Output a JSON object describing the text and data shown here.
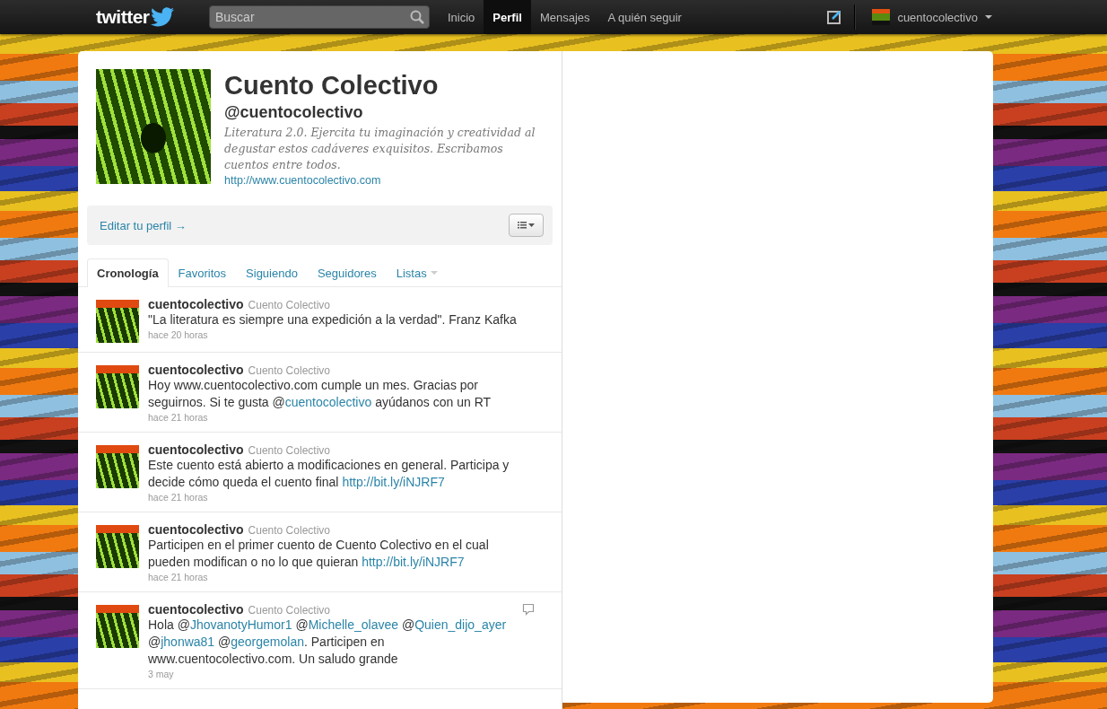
{
  "topbar": {
    "logo": "twitter",
    "search": {
      "placeholder": "Buscar"
    },
    "nav": [
      {
        "label": "Inicio",
        "selected": false
      },
      {
        "label": "Perfil",
        "selected": true
      },
      {
        "label": "Mensajes",
        "selected": false
      },
      {
        "label": "A quién seguir",
        "selected": false
      }
    ],
    "account": {
      "username": "cuentocolectivo"
    }
  },
  "profile": {
    "name": "Cuento Colectivo",
    "handle": "@cuentocolectivo",
    "bio": "Literatura 2.0. Ejercita tu imaginación y creatividad al degustar estos cadáveres exquisitos. Escribamos cuentos entre todos.",
    "url": "http://www.cuentocolectivo.com",
    "edit_link": "Editar tu perfil →"
  },
  "tabs": [
    {
      "label": "Cronología",
      "selected": true,
      "dropdown": false
    },
    {
      "label": "Favoritos",
      "selected": false,
      "dropdown": false
    },
    {
      "label": "Siguiendo",
      "selected": false,
      "dropdown": false
    },
    {
      "label": "Seguidores",
      "selected": false,
      "dropdown": false
    },
    {
      "label": "Listas",
      "selected": false,
      "dropdown": true
    }
  ],
  "tweets": [
    {
      "username": "cuentocolectivo",
      "full_name": "Cuento Colectivo",
      "time": "hace 20 horas",
      "hovered": false,
      "body": [
        {
          "kind": "text",
          "text": "\"La literatura es siempre una expedición a la verdad\". Franz Kafka"
        }
      ]
    },
    {
      "username": "cuentocolectivo",
      "full_name": "Cuento Colectivo",
      "time": "hace 21 horas",
      "hovered": false,
      "body": [
        {
          "kind": "text",
          "text": "Hoy www.cuentocolectivo.com cumple un mes. Gracias por seguirnos. Si te gusta @"
        },
        {
          "kind": "link",
          "text": "cuentocolectivo"
        },
        {
          "kind": "text",
          "text": " ayúdanos con un RT"
        }
      ]
    },
    {
      "username": "cuentocolectivo",
      "full_name": "Cuento Colectivo",
      "time": "hace 21 horas",
      "hovered": false,
      "body": [
        {
          "kind": "text",
          "text": "Este cuento está abierto a modificaciones en general. Participa y decide cómo queda el cuento final "
        },
        {
          "kind": "link",
          "text": "http://bit.ly/iNJRF7"
        }
      ]
    },
    {
      "username": "cuentocolectivo",
      "full_name": "Cuento Colectivo",
      "time": "hace 21 horas",
      "hovered": false,
      "body": [
        {
          "kind": "text",
          "text": "Participen en el primer cuento de Cuento Colectivo en el cual pueden modifican o no lo que quieran "
        },
        {
          "kind": "link",
          "text": "http://bit.ly/iNJRF7"
        }
      ]
    },
    {
      "username": "cuentocolectivo",
      "full_name": "Cuento Colectivo",
      "time": "3 may",
      "hovered": true,
      "body": [
        {
          "kind": "text",
          "text": "Hola @"
        },
        {
          "kind": "link",
          "text": "JhovanotyHumor1"
        },
        {
          "kind": "text",
          "text": " @"
        },
        {
          "kind": "link",
          "text": "Michelle_olavee"
        },
        {
          "kind": "text",
          "text": " @"
        },
        {
          "kind": "link",
          "text": "Quien_dijo_ayer"
        },
        {
          "kind": "text",
          "text": " @"
        },
        {
          "kind": "link",
          "text": "jhonwa81"
        },
        {
          "kind": "text",
          "text": " @"
        },
        {
          "kind": "link",
          "text": "georgemolan"
        },
        {
          "kind": "text",
          "text": ". Participen en www.cuentocolectivo.com. Un saludo grande"
        }
      ]
    }
  ]
}
